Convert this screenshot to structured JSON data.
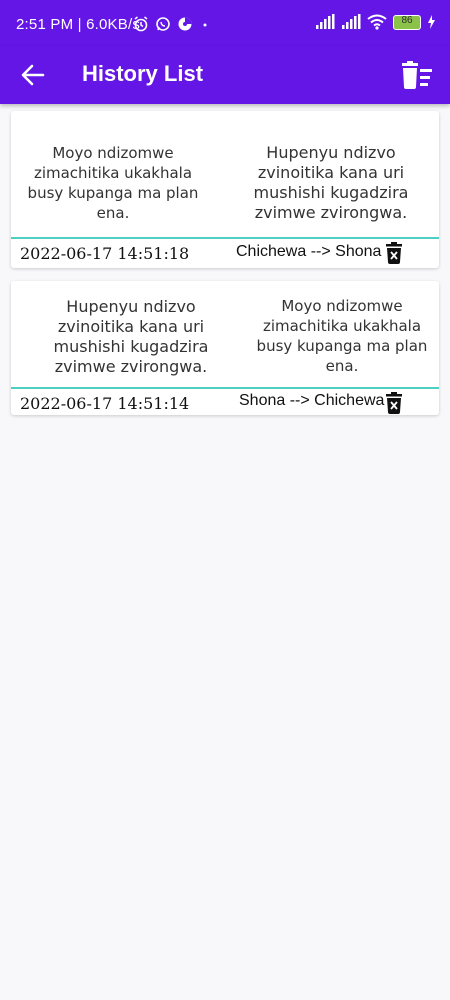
{
  "status_bar": {
    "time": "2:51 PM | 6.0KB/s",
    "battery": "86"
  },
  "app_bar": {
    "title": "History List"
  },
  "history": [
    {
      "source_text": "Moyo ndizomwe zimachitika ukakhala busy kupanga ma plan ena.",
      "target_text": "Hupenyu ndizvo zvinoitika kana uri mushishi kugadzira zvimwe zvirongwa.",
      "date": "2022-06-17 14:51:18",
      "from_lang": "Chichewa",
      "arrow": "-->",
      "to_lang": "Shona"
    },
    {
      "source_text": "Hupenyu ndizvo zvinoitika kana uri mushishi kugadzira zvimwe zvirongwa.",
      "target_text": "Moyo ndizomwe zimachitika ukakhala busy kupanga ma plan ena.",
      "date": "2022-06-17 14:51:14",
      "from_lang": "Shona",
      "arrow": "-->",
      "to_lang": "Chichewa"
    }
  ],
  "colors": {
    "primary": "#6416e6",
    "divider": "#4dd0c4",
    "background": "#f8f8fa"
  },
  "icons": {
    "back": "arrow-left-icon",
    "clear_all": "delete-sweep-icon",
    "delete": "trash-can-icon"
  }
}
